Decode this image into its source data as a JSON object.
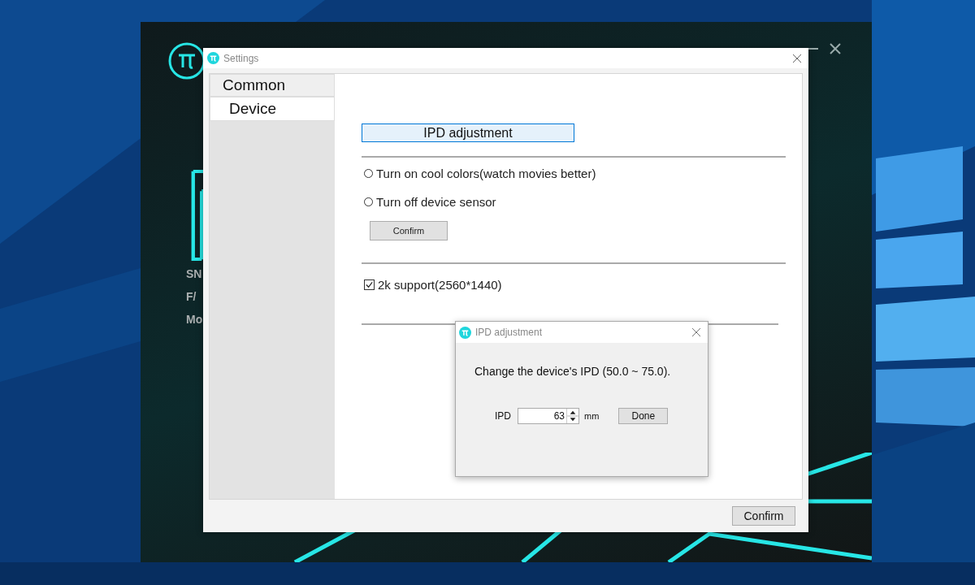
{
  "app": {
    "side_labels": [
      "SN",
      "F/",
      "Mo"
    ]
  },
  "settings": {
    "title": "Settings",
    "nav": [
      {
        "label": "Common",
        "selected": false
      },
      {
        "label": "Device",
        "selected": true
      }
    ],
    "ipd_button": "IPD adjustment",
    "radios": [
      {
        "label": "Turn on cool colors(watch movies better)",
        "checked": false
      },
      {
        "label": "Turn off device sensor",
        "checked": false
      }
    ],
    "radio_confirm": "Confirm",
    "checkboxes": [
      {
        "label": "2k support(2560*1440)",
        "checked": true
      }
    ],
    "footer_button": "Confirm"
  },
  "ipd_dialog": {
    "title": "IPD adjustment",
    "message": "Change the device's IPD (50.0 ~ 75.0).",
    "field_label": "IPD",
    "value": "63",
    "unit": "mm",
    "button": "Done"
  }
}
